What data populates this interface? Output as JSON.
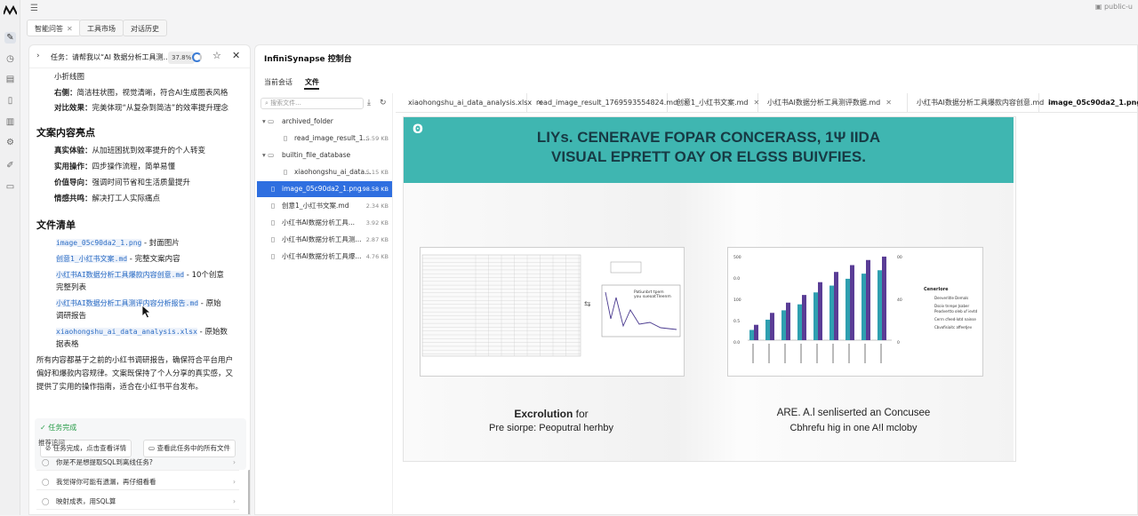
{
  "app": {
    "account": "public-u",
    "sidebar_toggle": "☰"
  },
  "top_tabs": [
    {
      "label": "智能问答",
      "closable": true,
      "active": true
    },
    {
      "label": "工具市场",
      "closable": false,
      "active": false
    },
    {
      "label": "对话历史",
      "closable": false,
      "active": false
    }
  ],
  "task": {
    "title": "任务：请帮我以“AI 数据分析工具测...",
    "progress": "37.8%",
    "progress_value": 0.378
  },
  "content": {
    "l1": "小折线图",
    "l2_key": "右侧：",
    "l2_val": "简洁柱状图，视觉清晰，符合AI生成图表风格",
    "l3_key": "对比效果：",
    "l3_val": "完美体现“从复杂到简洁”的效率提升理念",
    "h_highlights": "文案内容亮点",
    "hl": [
      {
        "k": "真实体验：",
        "v": "从加班困扰到效率提升的个人转变"
      },
      {
        "k": "实用操作：",
        "v": "四步操作流程，简单易懂"
      },
      {
        "k": "价值导向：",
        "v": "强调时间节省和生活质量提升"
      },
      {
        "k": "情感共鸣：",
        "v": "解决打工人实际痛点"
      }
    ],
    "h_files": "文件清单",
    "files": [
      {
        "name": "image_05c90da2_1.png",
        "desc": " - 封面图片",
        "desc2": ""
      },
      {
        "name": "创意1_小红书文案.md",
        "desc": " - 完整文案内容",
        "desc2": ""
      },
      {
        "name": "小红书AI数据分析工具爆款内容创意.md",
        "desc": " - 10个创意",
        "desc2": "完整列表"
      },
      {
        "name": "小红书AI数据分析工具测评内容分析报告.md",
        "desc": " - 原始",
        "desc2": "调研报告"
      },
      {
        "name": "xiaohongshu_ai_data_analysis.xlsx",
        "desc": " - 原始数",
        "desc2": "据表格"
      }
    ],
    "summary": [
      "所有内容都基于之前的小红书调研报告，确保符合平台用户",
      "偏好和爆款内容规律。文案既保持了个人分享的真实感，又",
      "提供了实用的操作指南，适合在小红书平台发布。"
    ],
    "done": "任务完成",
    "done_btn1": "任务完成，点击查看详情",
    "done_btn2": "查看此任务中的所有文件",
    "recommend": "推荐追问",
    "questions": [
      "你是不是想提取SQL到离线任务?",
      "我觉得你可能有遗漏，再仔细看看",
      "映射成表，用SQL算"
    ]
  },
  "console": {
    "title": "InfiniSynapse 控制台",
    "tabs": [
      {
        "label": "当前会话",
        "active": false
      },
      {
        "label": "文件",
        "active": true
      }
    ],
    "search_placeholder": "搜索文件...",
    "tree": [
      {
        "label": "archived_folder",
        "size": "",
        "level": 0,
        "folder": true,
        "selected": false
      },
      {
        "label": "read_image_result_1...",
        "size": "5.59 KB",
        "level": 1,
        "folder": false,
        "selected": false
      },
      {
        "label": "builtin_file_database",
        "size": "",
        "level": 0,
        "folder": true,
        "selected": false
      },
      {
        "label": "xiaohongshu_ai_data...",
        "size": "5.15 KB",
        "level": 1,
        "folder": false,
        "selected": false
      },
      {
        "label": "image_05c90da2_1.png",
        "size": "198.58 KB",
        "level": 0,
        "folder": false,
        "selected": true
      },
      {
        "label": "创意1_小红书文案.md",
        "size": "2.34 KB",
        "level": 0,
        "folder": false,
        "selected": false
      },
      {
        "label": "小红书AI数据分析工具...",
        "size": "3.92 KB",
        "level": 0,
        "folder": false,
        "selected": false
      },
      {
        "label": "小红书AI数据分析工具测...",
        "size": "2.87 KB",
        "level": 0,
        "folder": false,
        "selected": false
      },
      {
        "label": "小红书AI数据分析工具爆...",
        "size": "4.76 KB",
        "level": 0,
        "folder": false,
        "selected": false
      }
    ],
    "file_tabs": [
      {
        "label": "xiaohongshu_ai_data_analysis.xlsx",
        "active": false
      },
      {
        "label": "read_image_result_1769593554824.md",
        "active": false
      },
      {
        "label": "创意1_小红书文案.md",
        "active": false
      },
      {
        "label": "小红书AI数据分析工具测评数据.md",
        "active": false
      },
      {
        "label": "小红书AI数据分析工具爆款内容创意.md",
        "active": false
      },
      {
        "label": "image_05c90da2_1.png",
        "active": true
      }
    ]
  },
  "image": {
    "banner_logo": "ʘ",
    "banner_line1": "LIYs. CENERAVE FOPAR CONCERASS, 1Ψ IIDA",
    "banner_line2": "VISUAL EPRETT OAY OR ELGSS BUIVFIES.",
    "left_caption_bold": "Excrolution",
    "left_caption_rest": " for",
    "left_caption2": "Pre siorpe: Peoputral herhby",
    "right_caption": "ARE. A.l senliserted an Concusee",
    "right_caption2": "Cbhrefu hig in one A!l mcloby",
    "legend_title": "Cenerlore",
    "legend_items": [
      "Denverlitle Demals",
      "Dsoiv tnrepe Jsaber",
      "Peadvertto oleb uf ievtd",
      "Cerrn cfeed-lotd nainse",
      "Cbvofisiaitc affeetjev"
    ],
    "mini_chart_label": "Patiunbrt tpem\nyou sueoatTleenm",
    "bar_ticks": [
      "500",
      "0.0",
      "100",
      "0.5",
      "0.0"
    ],
    "bar_ticks_r": [
      "00",
      "40",
      "0"
    ],
    "bar_values_a": [
      12,
      24,
      35,
      42,
      56,
      64,
      72,
      78,
      82
    ],
    "bar_values_b": [
      18,
      32,
      44,
      53,
      68,
      80,
      88,
      94,
      98
    ]
  }
}
